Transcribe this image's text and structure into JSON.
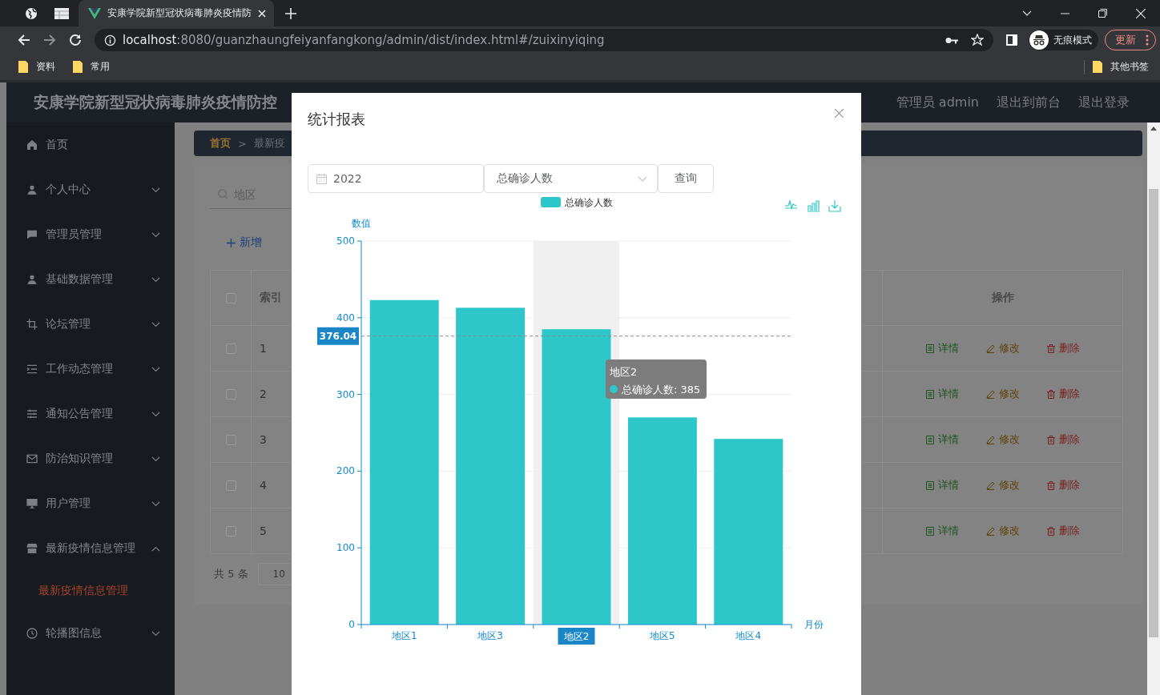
{
  "browser": {
    "tabs": [
      {
        "kind": "globe",
        "selected": false
      },
      {
        "kind": "sheet",
        "selected": false
      },
      {
        "kind": "vue",
        "title": "安康学院新型冠状病毒肺炎疫情防",
        "selected": true
      }
    ],
    "address": {
      "host": "localhost",
      "path": ":8080/guanzhaungfeiyanfangkong/admin/dist/index.html#/zuixinyiqing"
    },
    "profile": "无痕模式",
    "update": "更新",
    "bookmarks": [
      "资料",
      "常用"
    ],
    "other_bookmarks": "其他书签"
  },
  "header": {
    "title": "安康学院新型冠状病毒肺炎疫情防控",
    "user": "管理员 admin",
    "links": [
      "退出到前台",
      "退出登录"
    ]
  },
  "sidebar": {
    "items": [
      {
        "label": "首页",
        "kind": "link"
      },
      {
        "label": "个人中心",
        "kind": "menu",
        "expanded": false
      },
      {
        "label": "管理员管理",
        "kind": "menu",
        "expanded": false
      },
      {
        "label": "基础数据管理",
        "kind": "menu",
        "expanded": false
      },
      {
        "label": "论坛管理",
        "kind": "menu",
        "expanded": false
      },
      {
        "label": "工作动态管理",
        "kind": "menu",
        "expanded": false
      },
      {
        "label": "通知公告管理",
        "kind": "menu",
        "expanded": false
      },
      {
        "label": "防治知识管理",
        "kind": "menu",
        "expanded": false
      },
      {
        "label": "用户管理",
        "kind": "menu",
        "expanded": false
      },
      {
        "label": "最新疫情信息管理",
        "kind": "menu",
        "expanded": true,
        "children": [
          {
            "label": "最新疫情信息管理",
            "selected": true
          }
        ]
      },
      {
        "label": "轮播图信息",
        "kind": "menu",
        "expanded": false
      }
    ]
  },
  "breadcrumb": {
    "items": [
      {
        "label": "首页",
        "current": false
      },
      {
        "label": "最新疫",
        "current": true
      }
    ],
    "separator": ">"
  },
  "search": {
    "placeholder": "地区"
  },
  "add_button": "新增",
  "table": {
    "columns": [
      "索引",
      "操作"
    ],
    "header_checked": false,
    "rows": [
      {
        "index": "1",
        "checked": false,
        "actions": [
          "详情",
          "修改",
          "删除"
        ]
      },
      {
        "index": "2",
        "checked": false,
        "actions": [
          "详情",
          "修改",
          "删除"
        ]
      },
      {
        "index": "3",
        "checked": false,
        "actions": [
          "详情",
          "修改",
          "删除"
        ]
      },
      {
        "index": "4",
        "checked": false,
        "actions": [
          "详情",
          "修改",
          "删除"
        ]
      },
      {
        "index": "5",
        "checked": false,
        "actions": [
          "详情",
          "修改",
          "删除"
        ]
      }
    ]
  },
  "pagination": {
    "total": "共 5 条",
    "page_size": "10"
  },
  "dialog": {
    "title": "统计报表",
    "year": "2022",
    "metric": "总确诊人数",
    "query_button": "查询",
    "chart_data": {
      "type": "bar",
      "xlabel": "月份",
      "ylabel": "数值",
      "categories": [
        "地区1",
        "地区3",
        "地区2",
        "地区5",
        "地区4"
      ],
      "series": [
        {
          "name": "总确诊人数",
          "color": "#2ec7c9",
          "values": [
            423,
            413,
            385,
            270,
            242
          ]
        }
      ],
      "ylim": [
        0,
        500
      ],
      "yticks": [
        0,
        100,
        200,
        300,
        400,
        500
      ],
      "grid": true,
      "ref_lines": [
        {
          "axis": "y",
          "value": 376.04,
          "label": "376.04"
        }
      ],
      "bands": [
        {
          "axis": "x",
          "from": "地区2",
          "to": "地区2"
        }
      ],
      "annotations": [
        "地区2",
        "总确诊人数: 385"
      ]
    }
  }
}
